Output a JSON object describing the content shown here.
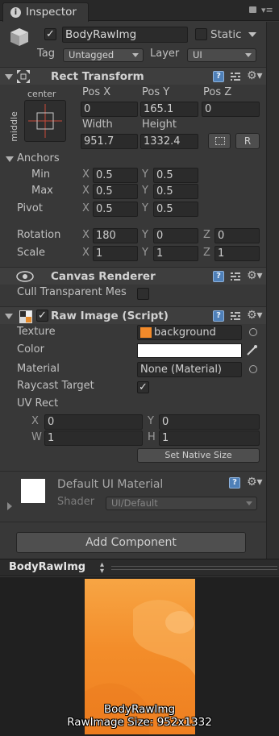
{
  "tab": {
    "title": "Inspector"
  },
  "header": {
    "name": "BodyRawImg",
    "static_label": "Static",
    "tag_label": "Tag",
    "tag_value": "Untagged",
    "layer_label": "Layer",
    "layer_value": "UI"
  },
  "rect_transform": {
    "title": "Rect Transform",
    "anchor_h": "center",
    "anchor_v": "middle",
    "pos_x_label": "Pos X",
    "pos_y_label": "Pos Y",
    "pos_z_label": "Pos Z",
    "pos_x": "0",
    "pos_y": "165.1",
    "pos_z": "0",
    "width_label": "Width",
    "height_label": "Height",
    "width": "951.7",
    "height": "1332.4",
    "r_button": "R",
    "anchors_label": "Anchors",
    "min_label": "Min",
    "max_label": "Max",
    "pivot_label": "Pivot",
    "min_x": "0.5",
    "min_y": "0.5",
    "max_x": "0.5",
    "max_y": "0.5",
    "pivot_x": "0.5",
    "pivot_y": "0.5",
    "rotation_label": "Rotation",
    "scale_label": "Scale",
    "rot_x": "180",
    "rot_y": "0",
    "rot_z": "0",
    "scale_x": "1",
    "scale_y": "1",
    "scale_z": "1",
    "axis_x": "X",
    "axis_y": "Y",
    "axis_z": "Z"
  },
  "canvas_renderer": {
    "title": "Canvas Renderer",
    "cull_label": "Cull Transparent Mes"
  },
  "raw_image": {
    "title": "Raw Image (Script)",
    "texture_label": "Texture",
    "texture_value": "background",
    "color_label": "Color",
    "color_value": "#ffffff",
    "material_label": "Material",
    "material_value": "None (Material)",
    "raycast_label": "Raycast Target",
    "uvrect_label": "UV Rect",
    "uv_x_label": "X",
    "uv_y_label": "Y",
    "uv_w_label": "W",
    "uv_h_label": "H",
    "uv_x": "0",
    "uv_y": "0",
    "uv_w": "1",
    "uv_h": "1",
    "native_size_button": "Set Native Size"
  },
  "material": {
    "name": "Default UI Material",
    "shader_label": "Shader",
    "shader_value": "UI/Default"
  },
  "add_component": "Add Component",
  "preview": {
    "title": "BodyRawImg",
    "caption_name": "BodyRawImg",
    "caption_size": "RawImage Size: 952x1332"
  },
  "colors": {
    "accent_orange": "#f28a2a",
    "bg": "#383838"
  }
}
